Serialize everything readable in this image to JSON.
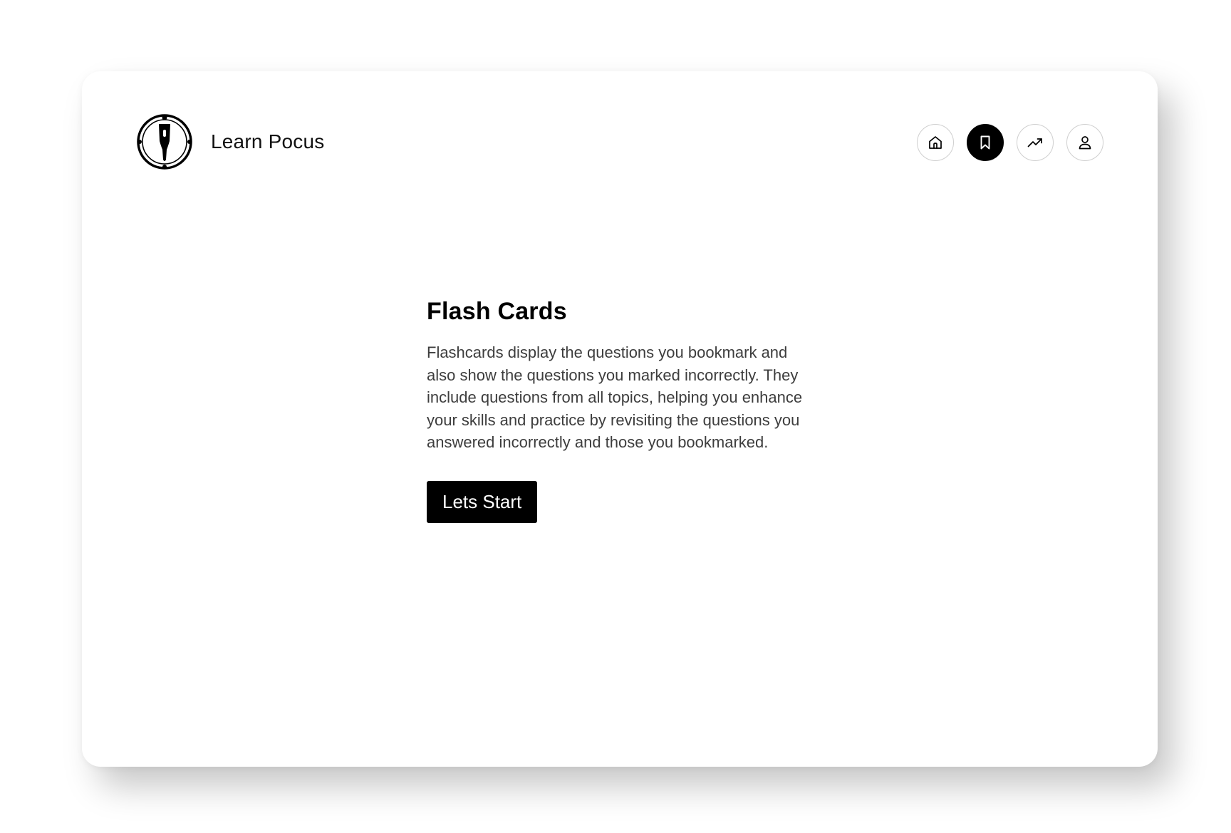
{
  "brand": {
    "name": "Learn Pocus",
    "logo_icon": "ultrasound-probe-logo-icon"
  },
  "nav": {
    "items": [
      {
        "icon": "home-icon",
        "active": false
      },
      {
        "icon": "bookmark-icon",
        "active": true
      },
      {
        "icon": "trending-up-icon",
        "active": false
      },
      {
        "icon": "user-icon",
        "active": false
      }
    ]
  },
  "main": {
    "title": "Flash Cards",
    "description": "Flashcards display the questions you bookmark and also show the questions you marked incorrectly. They include questions from all topics, helping you enhance your skills and practice by revisiting the questions you answered incorrectly and those you bookmarked.",
    "cta_label": "Lets Start"
  },
  "colors": {
    "accent": "#000000",
    "background": "#ffffff",
    "body_text": "#3d3d3d"
  }
}
